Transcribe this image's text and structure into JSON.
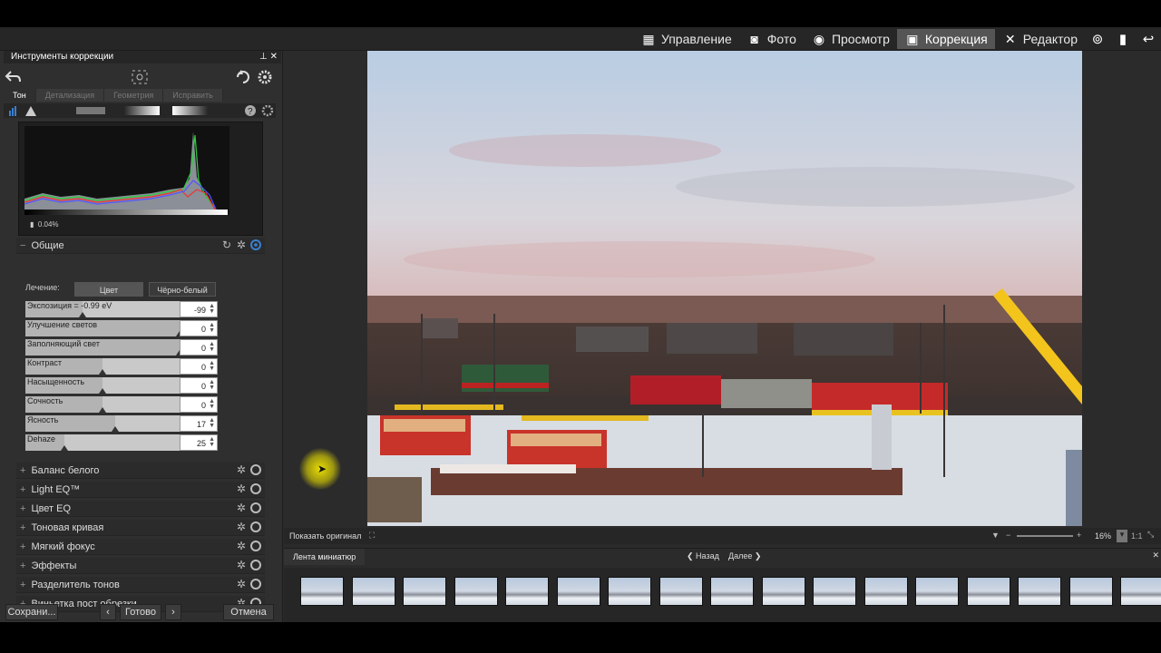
{
  "topbar": {
    "modes": [
      {
        "label": "Управление",
        "icon": "grid-icon",
        "glyph": "▦",
        "active": false
      },
      {
        "label": "Фото",
        "icon": "camera-icon",
        "glyph": "◙",
        "active": false
      },
      {
        "label": "Просмотр",
        "icon": "eye-icon",
        "glyph": "◉",
        "active": false
      },
      {
        "label": "Коррекция",
        "icon": "correction-icon",
        "glyph": "▣",
        "active": true
      },
      {
        "label": "Редактор",
        "icon": "tools-icon",
        "glyph": "✕",
        "active": false
      }
    ],
    "right_icons": [
      {
        "name": "365-icon",
        "glyph": "⊚"
      },
      {
        "name": "stats-icon",
        "glyph": "▮"
      },
      {
        "name": "share-icon",
        "glyph": "↩"
      }
    ]
  },
  "panel": {
    "title": "Инструменты коррекции",
    "title_buttons": "⊥ ✕",
    "tabs": [
      "Тон",
      "Детализация",
      "Геометрия",
      "Исправить"
    ],
    "histogram": {
      "clip_text": "0.04%"
    },
    "general": {
      "title": "Общие",
      "mode_label": "Лечение:",
      "mode_color": "Цвет",
      "mode_bw": "Чёрно-белый",
      "sliders": [
        {
          "label": "Экспозиция = -0.99 eV",
          "value": "-99",
          "level": 0.37
        },
        {
          "label": "Улучшение светов",
          "value": "0",
          "level": 1.0
        },
        {
          "label": "Заполняющий свет",
          "value": "0",
          "level": 1.0
        },
        {
          "label": "Контраст",
          "value": "0",
          "level": 0.5
        },
        {
          "label": "Насыщенность",
          "value": "0",
          "level": 0.5
        },
        {
          "label": "Сочность",
          "value": "0",
          "level": 0.5
        },
        {
          "label": "Ясность",
          "value": "17",
          "level": 0.58
        },
        {
          "label": "Dehaze",
          "value": "25",
          "level": 0.25
        }
      ]
    },
    "sections": [
      "Баланс белого",
      "Light EQ™",
      "Цвет EQ",
      "Тоновая кривая",
      "Мягкий фокус",
      "Эффекты",
      "Разделитель тонов",
      "Виньетка пост обрезки"
    ],
    "buttons": {
      "save": "Сохрани...",
      "done": "Готово",
      "cancel": "Отмена",
      "prev": "‹",
      "next": "›"
    }
  },
  "viewer": {
    "show_original": "Показать оригинал",
    "zoom": "16%",
    "zoom_ratio": "1:1"
  },
  "filmstrip": {
    "title": "Лента миниатюр",
    "back": "Назад",
    "forward": "Далее",
    "thumb_count": 18
  },
  "colors": {
    "accent": "#3b7fd0",
    "active_mode_bg": "#555555"
  }
}
